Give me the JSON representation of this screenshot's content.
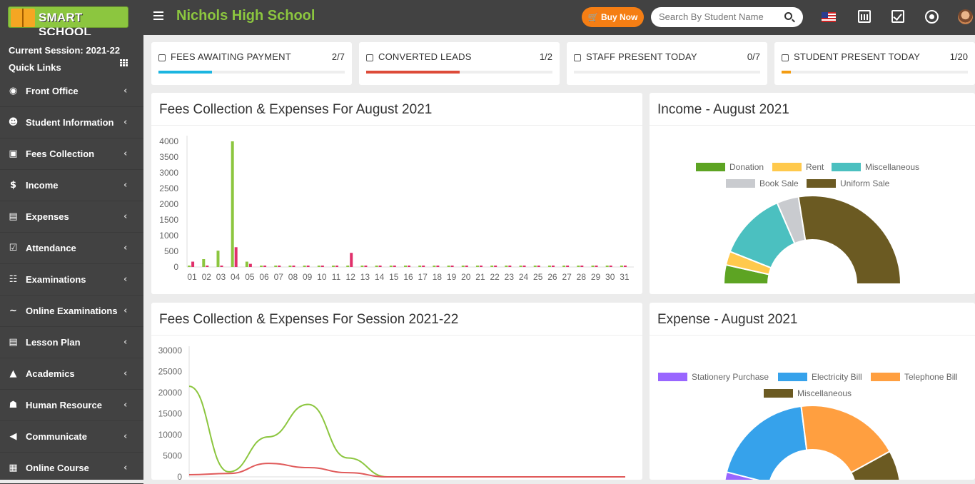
{
  "header": {
    "logo_text": "SMART SCHOOL",
    "school_name": "Nichols High School",
    "buy_now": "Buy Now",
    "search_placeholder": "Search By Student Name"
  },
  "sidebar": {
    "session": "Current Session: 2021-22",
    "quick_links": "Quick Links",
    "items": [
      {
        "label": "Front Office",
        "icon": "eye-icon"
      },
      {
        "label": "Student Information",
        "icon": "users-icon"
      },
      {
        "label": "Fees Collection",
        "icon": "money-icon"
      },
      {
        "label": "Income",
        "icon": "dollar-icon"
      },
      {
        "label": "Expenses",
        "icon": "credit-card-icon"
      },
      {
        "label": "Attendance",
        "icon": "calendar-check-icon"
      },
      {
        "label": "Examinations",
        "icon": "map-icon"
      },
      {
        "label": "Online Examinations",
        "icon": "rss-icon"
      },
      {
        "label": "Lesson Plan",
        "icon": "list-icon"
      },
      {
        "label": "Academics",
        "icon": "graduation-cap-icon"
      },
      {
        "label": "Human Resource",
        "icon": "sitemap-icon"
      },
      {
        "label": "Communicate",
        "icon": "bullhorn-icon"
      },
      {
        "label": "Online Course",
        "icon": "file-icon"
      }
    ]
  },
  "stats": [
    {
      "title": "FEES AWAITING PAYMENT",
      "value": "2/7",
      "fraction": 0.2857,
      "color": "#1cb5e0"
    },
    {
      "title": "CONVERTED LEADS",
      "value": "1/2",
      "fraction": 0.5,
      "color": "#dd4b39"
    },
    {
      "title": "STAFF PRESENT TODAY",
      "value": "0/7",
      "fraction": 0,
      "color": "#00a65a"
    },
    {
      "title": "STUDENT PRESENT TODAY",
      "value": "1/20",
      "fraction": 0.05,
      "color": "#f39c12"
    }
  ],
  "panels": {
    "fees_month_title": "Fees Collection & Expenses For August 2021",
    "income_title": "Income - August 2021",
    "fees_session_title": "Fees Collection & Expenses For Session 2021-22",
    "expense_title": "Expense - August 2021"
  },
  "colors": {
    "fees_series": "#8cc63f",
    "expense_series": "#e0306b",
    "session_fees": "#8cc63f",
    "session_expense": "#e05a5a"
  },
  "chart_data": [
    {
      "type": "bar",
      "categories": [
        "01",
        "02",
        "03",
        "04",
        "05",
        "06",
        "07",
        "08",
        "09",
        "10",
        "11",
        "12",
        "13",
        "14",
        "15",
        "16",
        "17",
        "18",
        "19",
        "20",
        "21",
        "22",
        "23",
        "24",
        "25",
        "26",
        "27",
        "28",
        "29",
        "30",
        "31"
      ],
      "series": [
        {
          "values": [
            30,
            250,
            520,
            4000,
            170,
            20,
            20,
            20,
            20,
            20,
            20,
            20,
            20,
            20,
            20,
            20,
            20,
            20,
            20,
            20,
            20,
            20,
            20,
            20,
            20,
            20,
            20,
            20,
            20,
            20,
            20
          ]
        },
        {
          "values": [
            170,
            30,
            30,
            630,
            100,
            20,
            20,
            20,
            20,
            20,
            20,
            450,
            20,
            20,
            20,
            20,
            20,
            20,
            20,
            20,
            20,
            20,
            20,
            20,
            20,
            20,
            20,
            20,
            20,
            20,
            20
          ]
        }
      ],
      "y_ticks": [
        "4000",
        "3500",
        "3000",
        "2500",
        "2000",
        "1500",
        "1000",
        "500",
        "0"
      ],
      "ylim": [
        0,
        4000
      ]
    },
    {
      "type": "pie",
      "variant": "half-doughnut",
      "labels": [
        "Donation",
        "Rent",
        "Miscellaneous",
        "Book Sale",
        "Uniform Sale"
      ],
      "colors": [
        "#5da423",
        "#ffc94c",
        "#4bc0c0",
        "#c9cbcf",
        "#6b5a22"
      ],
      "values": [
        7,
        5,
        25,
        8,
        55
      ]
    },
    {
      "type": "line",
      "series": [
        {
          "color": "#8cc63f",
          "values": [
            21500,
            1200,
            9500,
            17200,
            4500,
            0,
            0,
            0,
            0,
            0,
            0,
            0
          ]
        },
        {
          "color": "#e05a5a",
          "values": [
            500,
            800,
            3200,
            2200,
            1000,
            0,
            0,
            0,
            0,
            0,
            0,
            0
          ]
        }
      ],
      "y_ticks": [
        "30000",
        "25000",
        "20000",
        "15000",
        "10000",
        "5000",
        "0"
      ],
      "ylim": [
        0,
        30000
      ]
    },
    {
      "type": "pie",
      "variant": "half-doughnut",
      "labels": [
        "Stationery Purchase",
        "Electricity Bill",
        "Telephone Bill",
        "Miscellaneous"
      ],
      "colors": [
        "#9966ff",
        "#36a2eb",
        "#ff9f40",
        "#6b5a22"
      ],
      "values": [
        8,
        38,
        38,
        16
      ]
    }
  ]
}
